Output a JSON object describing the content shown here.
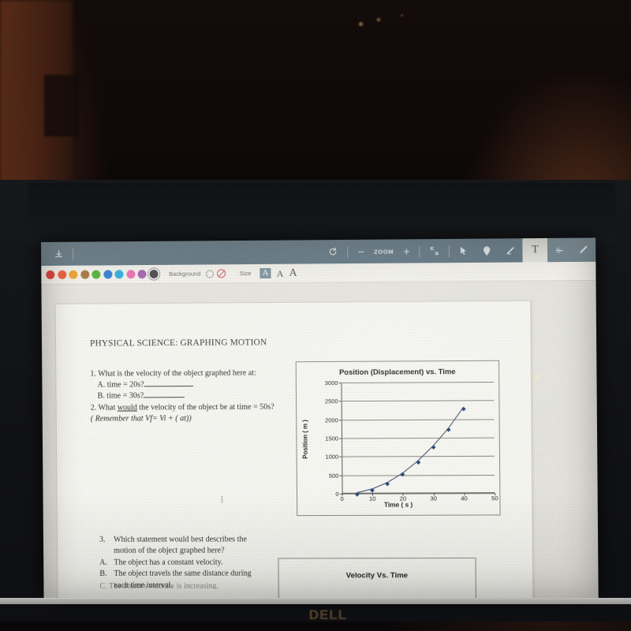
{
  "device": {
    "brand_logo": "DELL"
  },
  "toolbar": {
    "download_icon": "download-icon",
    "rotate_label": "rotate-icon",
    "zoom_out_label": "−",
    "zoom_label": "ZOOM",
    "zoom_in_label": "+",
    "fit_label": "fit-icon",
    "cursor_label": "cursor-icon",
    "pin_label": "pin-icon",
    "highlighter_label": "highlighter-icon",
    "text_label": "T",
    "strikethrough_label": "S",
    "pen_label": "pen-icon"
  },
  "subbar": {
    "background_label": "Background",
    "size_label": "Size",
    "size_options": [
      "A",
      "A",
      "A"
    ],
    "selected_size_index": 0,
    "colors": [
      "#e2342e",
      "#ef5b33",
      "#f0a32b",
      "#a9743f",
      "#4eb53b",
      "#2f7fd6",
      "#2fb0e0",
      "#ef6fb8",
      "#a563b0",
      "#4a4a4a"
    ],
    "selected_color_index": 9
  },
  "document": {
    "title": "PHYSICAL SCIENCE: GRAPHING MOTION",
    "q1_stem": "1. What is the velocity of the object graphed here at:",
    "q1_a": "A. time = 20s?",
    "q1_b": "B. time = 30s?",
    "q2_pre": "2. What ",
    "q2_under": "would",
    "q2_post": " the velocity of the object be at time = 50s?",
    "q2_hint": "( Remember that Vf= Vi + ( at))",
    "q3_num": "3.",
    "q3_line1": "Which statement would best describes the",
    "q3_line2": "motion of the object graphed here?",
    "q3_a_num": "A.",
    "q3_a_text": "The object has a constant velocity.",
    "q3_b_num": "B.",
    "q3_b_line1": "The object travels the same distance during",
    "q3_b_line2": "each time interval.",
    "q3_c_cut": "C.  The object's velocity is increasing.",
    "caret": "I"
  },
  "chart_data": [
    {
      "type": "scatter",
      "title": "Position (Displacement) vs. Time",
      "xlabel": "Time ( s )",
      "ylabel": "Position ( m )",
      "xlim": [
        0,
        50
      ],
      "ylim": [
        0,
        3000
      ],
      "xticks": [
        0,
        10,
        20,
        30,
        40,
        50
      ],
      "yticks": [
        0,
        500,
        1000,
        1500,
        2000,
        2500,
        3000
      ],
      "grid": true,
      "legend": "none",
      "marker_color": "#2e4a7d",
      "line_color": "#4a5a7a",
      "x": [
        5,
        10,
        15,
        20,
        25,
        30,
        35,
        40
      ],
      "y": [
        25,
        125,
        300,
        550,
        880,
        1280,
        1750,
        2320
      ]
    },
    {
      "type": "scatter",
      "title": "Velocity Vs. Time",
      "xlabel": "",
      "ylabel": "",
      "x": [],
      "y": []
    }
  ]
}
